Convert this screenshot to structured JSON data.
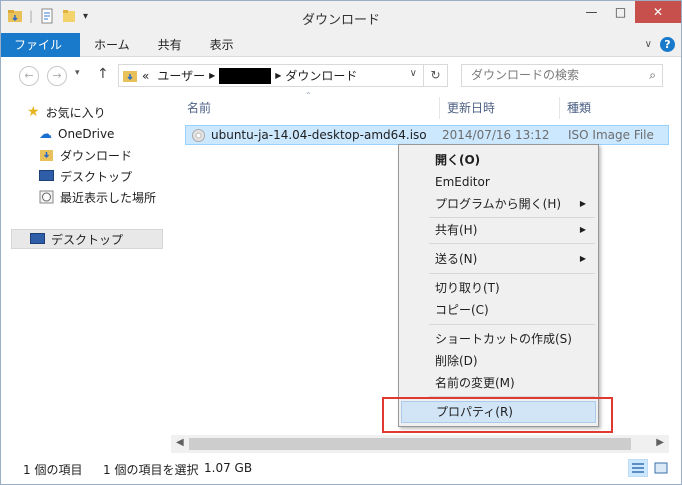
{
  "window": {
    "title": "ダウンロード"
  },
  "ribbon": {
    "tabs": [
      "ファイル",
      "ホーム",
      "共有",
      "表示"
    ]
  },
  "address": {
    "crumb1": "ユーザー",
    "crumb2": "ダウンロード",
    "prefix": "«"
  },
  "search": {
    "placeholder": "ダウンロードの検索"
  },
  "navpane": {
    "favorites": "お気に入り",
    "onedrive": "OneDrive",
    "downloads": "ダウンロード",
    "desktop": "デスクトップ",
    "recent": "最近表示した場所",
    "desktop_group": "デスクトップ"
  },
  "columns": {
    "name": "名前",
    "date": "更新日時",
    "type": "種類"
  },
  "file": {
    "name": "ubuntu-ja-14.04-desktop-amd64.iso",
    "date": "2014/07/16 13:12",
    "type": "ISO Image File"
  },
  "status": {
    "count": "1 個の項目",
    "selected": "1 個の項目を選択",
    "size": "1.07 GB"
  },
  "menu": {
    "open": "開く(O)",
    "emeditor": "EmEditor",
    "open_with": "プログラムから開く(H)",
    "share": "共有(H)",
    "send_to": "送る(N)",
    "cut": "切り取り(T)",
    "copy": "コピー(C)",
    "shortcut": "ショートカットの作成(S)",
    "delete": "削除(D)",
    "rename": "名前の変更(M)",
    "properties": "プロパティ(R)"
  },
  "colors": {
    "accent": "#1979ca",
    "selection": "#cce8ff",
    "highlight_box": "#e0392f"
  }
}
